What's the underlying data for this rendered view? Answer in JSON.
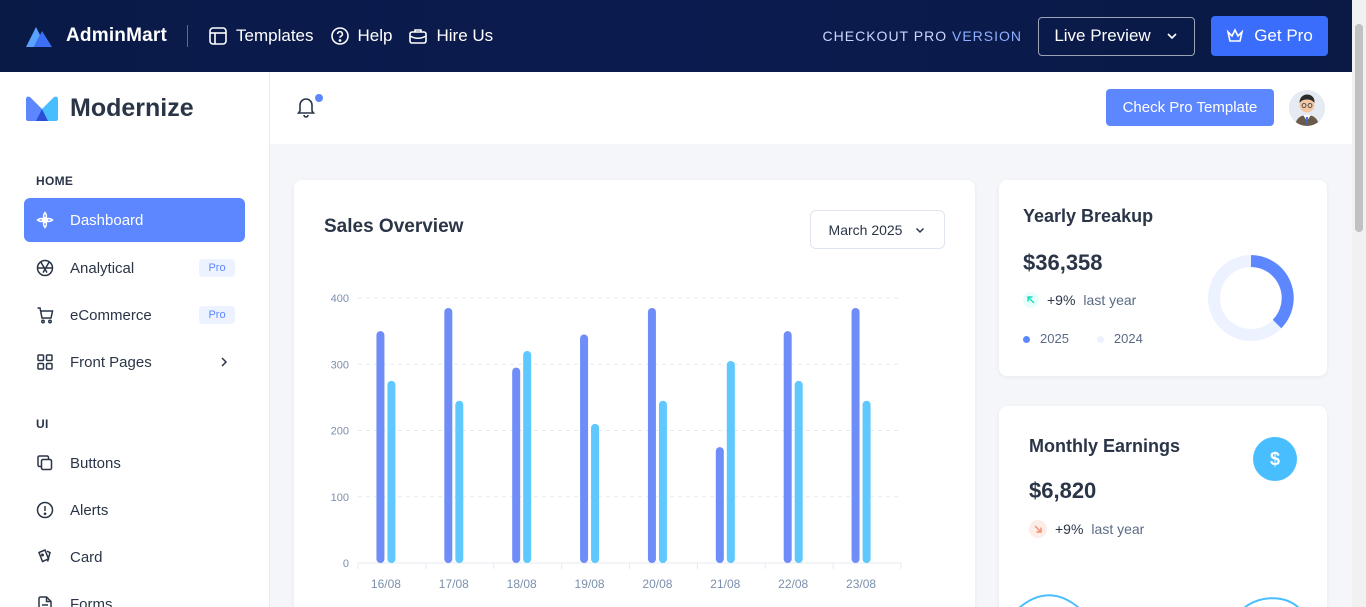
{
  "topbar": {
    "brand": "AdminMart",
    "links": [
      "Templates",
      "Help",
      "Hire Us"
    ],
    "checkout_prefix": "CHECKOUT PRO ",
    "checkout_suffix": "VERSION",
    "live_preview": "Live Preview",
    "get_pro": "Get Pro"
  },
  "sidebar": {
    "brand": "Modernize",
    "home_caption": "HOME",
    "ui_caption": "UI",
    "items": [
      {
        "label": "Dashboard",
        "icon": "aperture-icon"
      },
      {
        "label": "Analytical",
        "icon": "aperture-icon",
        "badge": "Pro"
      },
      {
        "label": "eCommerce",
        "icon": "cart-icon",
        "badge": "Pro"
      },
      {
        "label": "Front Pages",
        "icon": "apps-icon"
      },
      {
        "label": "Buttons",
        "icon": "copy-icon"
      },
      {
        "label": "Alerts",
        "icon": "alert-circle-icon"
      },
      {
        "label": "Card",
        "icon": "cards-icon"
      },
      {
        "label": "Forms",
        "icon": "file-text-icon"
      }
    ]
  },
  "header": {
    "check_pro": "Check Pro Template"
  },
  "sales": {
    "title": "Sales Overview",
    "month": "March 2025"
  },
  "yearly": {
    "title": "Yearly Breakup",
    "amount": "$36,358",
    "trend": "+9%",
    "trend_suffix": "last year",
    "legend": [
      "2025",
      "2024"
    ]
  },
  "monthly": {
    "title": "Monthly Earnings",
    "amount": "$6,820",
    "trend": "+9%",
    "trend_suffix": "last year"
  },
  "colors": {
    "primary": "#5d87ff",
    "secondary": "#49beff",
    "bar_a": "#6f8df8",
    "bar_b": "#5ec8ff"
  },
  "chart_data": {
    "type": "bar",
    "categories": [
      "16/08",
      "17/08",
      "18/08",
      "19/08",
      "20/08",
      "21/08",
      "22/08",
      "23/08"
    ],
    "series": [
      {
        "values": [
          350,
          385,
          295,
          345,
          385,
          175,
          350,
          385
        ]
      },
      {
        "values": [
          275,
          245,
          320,
          210,
          245,
          305,
          275,
          245
        ]
      }
    ],
    "yticks": [
      0,
      100,
      200,
      300,
      400
    ],
    "ylim": [
      0,
      400
    ],
    "grid": true
  }
}
